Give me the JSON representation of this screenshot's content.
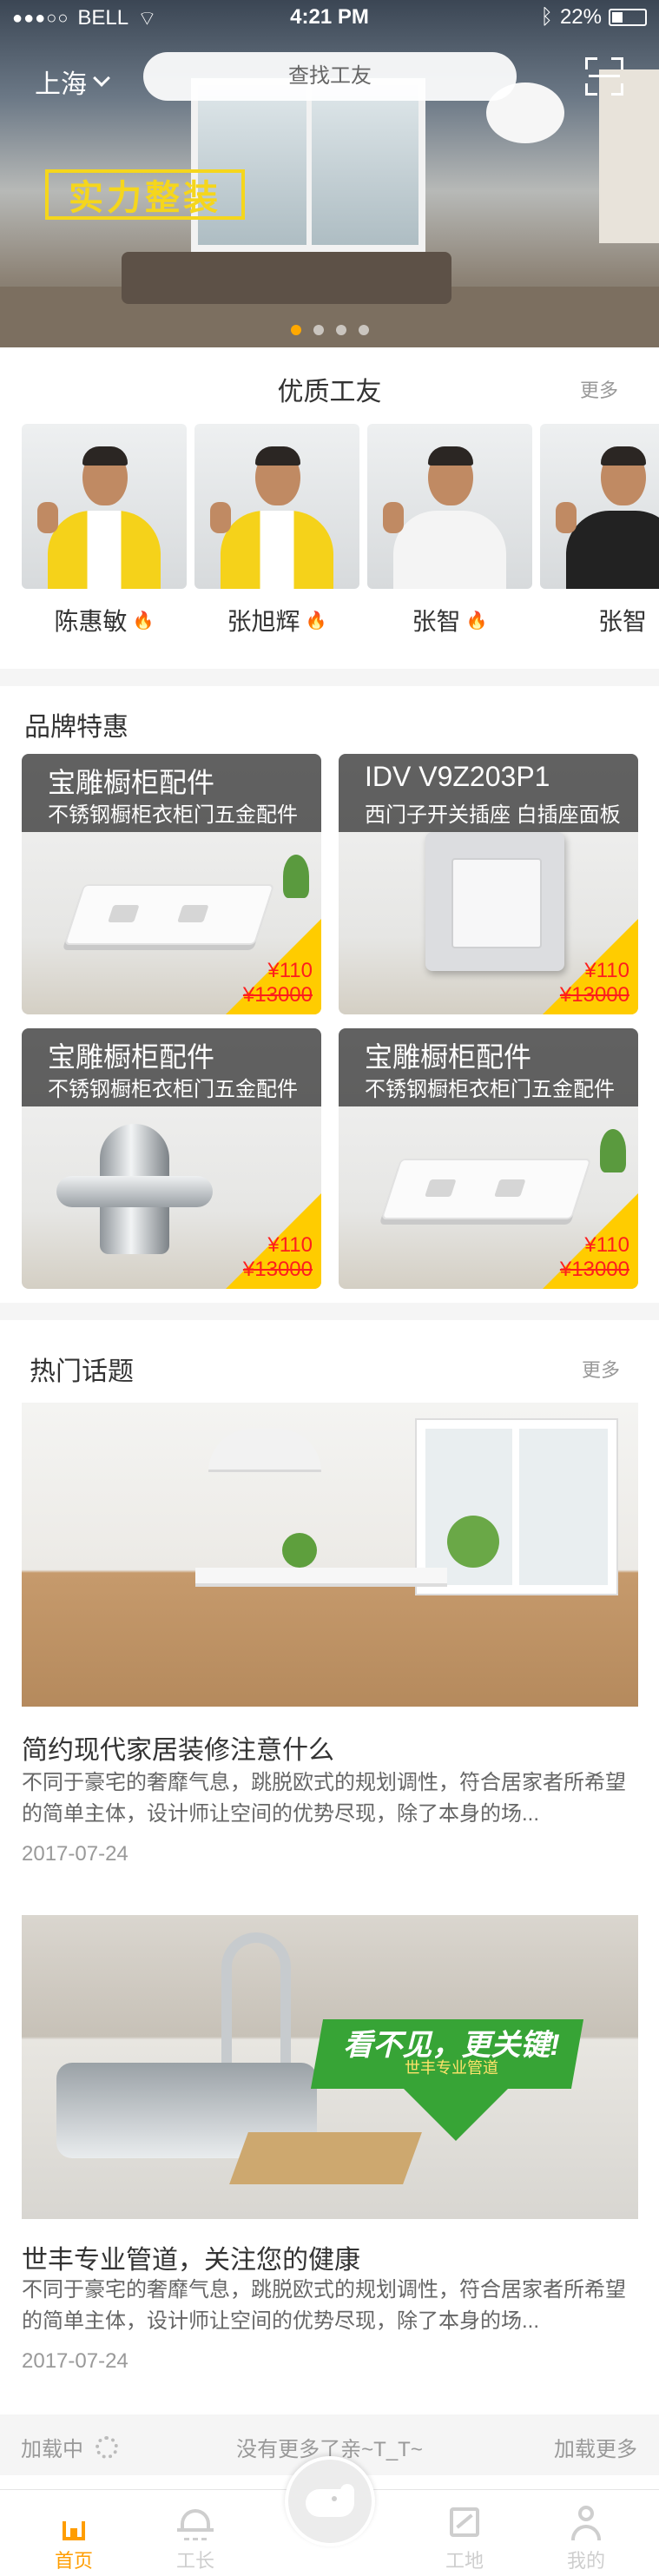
{
  "status_bar": {
    "carrier": "BELL",
    "time": "4:21 PM",
    "battery": "22%"
  },
  "header": {
    "city": "上海",
    "search_placeholder": "查找工友",
    "slogan": "实力整装",
    "pager_count": 4,
    "pager_active_index": 0
  },
  "workers": {
    "title": "优质工友",
    "more": "更多",
    "items": [
      {
        "name": "陈惠敏",
        "hot": true,
        "uniform": "yellow"
      },
      {
        "name": "张旭辉",
        "hot": true,
        "uniform": "yellow"
      },
      {
        "name": "张智",
        "hot": true,
        "uniform": "white"
      },
      {
        "name": "张智",
        "hot": false,
        "uniform": "black"
      }
    ]
  },
  "brands": {
    "title": "品牌特惠",
    "items": [
      {
        "name": "宝雕橱柜配件",
        "desc": "不锈钢橱柜衣柜门五金配件",
        "price": "¥110",
        "original_price": "¥13000",
        "image": "outlet"
      },
      {
        "name": "IDV V9Z203P1",
        "desc": "西门子开关插座 白插座面板",
        "price": "¥110",
        "original_price": "¥13000",
        "image": "switch"
      },
      {
        "name": "宝雕橱柜配件",
        "desc": "不锈钢橱柜衣柜门五金配件",
        "price": "¥110",
        "original_price": "¥13000",
        "image": "valve"
      },
      {
        "name": "宝雕橱柜配件",
        "desc": "不锈钢橱柜衣柜门五金配件",
        "price": "¥110",
        "original_price": "¥13000",
        "image": "outlet"
      }
    ]
  },
  "topics": {
    "title": "热门话题",
    "more": "更多",
    "items": [
      {
        "title": "简约现代家居装修注意什么",
        "desc": "不同于豪宅的奢靡气息，跳脱欧式的规划调性，符合居家者所希望的简单主体，设计师让空间的优势尽现，除了本身的场...",
        "date": "2017-07-24"
      },
      {
        "title": "世丰专业管道，关注您的健康",
        "desc": "不同于豪宅的奢靡气息，跳脱欧式的规划调性，符合居家者所希望的简单主体，设计师让空间的优势尽现，除了本身的场...",
        "date": "2017-07-24",
        "ad_headline": "看不见，更关键!",
        "ad_subline": "世丰专业管道"
      }
    ]
  },
  "load_more": {
    "loading": "加载中",
    "no_more": "没有更多了亲~T_T~",
    "more": "加载更多"
  },
  "tabbar": {
    "items": [
      {
        "label": "首页",
        "icon": "home-icon",
        "active": true
      },
      {
        "label": "工长",
        "icon": "hardhat-icon",
        "active": false
      },
      {
        "label": "工地",
        "icon": "site-icon",
        "active": false
      },
      {
        "label": "我的",
        "icon": "user-icon",
        "active": false
      }
    ]
  },
  "colors": {
    "accent": "#ff9d00",
    "pager_active": "#ffa800",
    "price": "#fe1e1d",
    "price_tag": "#ffcc00",
    "title_text": "#333333",
    "body_text": "#666666",
    "muted_text": "#999999",
    "tab_inactive": "#cecece",
    "divider": "#f5f5f5",
    "hot_icon": "#ff5a2a"
  }
}
